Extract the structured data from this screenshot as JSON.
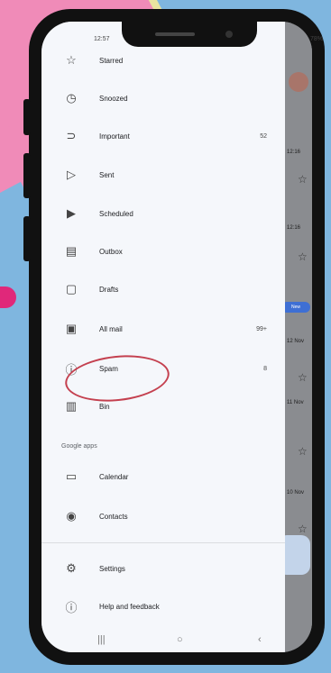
{
  "status": {
    "time": "12:57",
    "battery": "78%"
  },
  "drawer": {
    "items": [
      {
        "icon": "star-icon",
        "glyph": "☆",
        "label": "Starred",
        "count": ""
      },
      {
        "icon": "clock-icon",
        "glyph": "◷",
        "label": "Snoozed",
        "count": ""
      },
      {
        "icon": "important-icon",
        "glyph": "⊃",
        "label": "Important",
        "count": "52"
      },
      {
        "icon": "send-icon",
        "glyph": "▷",
        "label": "Sent",
        "count": ""
      },
      {
        "icon": "schedule-send-icon",
        "glyph": "▶",
        "label": "Scheduled",
        "count": ""
      },
      {
        "icon": "outbox-icon",
        "glyph": "▤",
        "label": "Outbox",
        "count": ""
      },
      {
        "icon": "draft-icon",
        "glyph": "▢",
        "label": "Drafts",
        "count": ""
      },
      {
        "icon": "all-mail-icon",
        "glyph": "▣",
        "label": "All mail",
        "count": "99+"
      },
      {
        "icon": "spam-icon",
        "glyph": "ⓘ",
        "label": "Spam",
        "count": "8"
      },
      {
        "icon": "bin-icon",
        "glyph": "▥",
        "label": "Bin",
        "count": ""
      }
    ],
    "google_apps_header": "Google apps",
    "apps": [
      {
        "icon": "calendar-icon",
        "glyph": "▭",
        "label": "Calendar"
      },
      {
        "icon": "contacts-icon",
        "glyph": "◉",
        "label": "Contacts"
      }
    ],
    "footer": [
      {
        "icon": "settings-icon",
        "glyph": "⚙",
        "label": "Settings"
      },
      {
        "icon": "help-icon",
        "glyph": "ⓘ",
        "label": "Help and feedback"
      }
    ]
  },
  "background_list": {
    "times": [
      "12:16",
      "12:16",
      "12 Nov",
      "11 Nov",
      "10 Nov"
    ],
    "badge": "New"
  },
  "nav": {
    "recents": "|||",
    "home": "○",
    "back": "‹"
  }
}
